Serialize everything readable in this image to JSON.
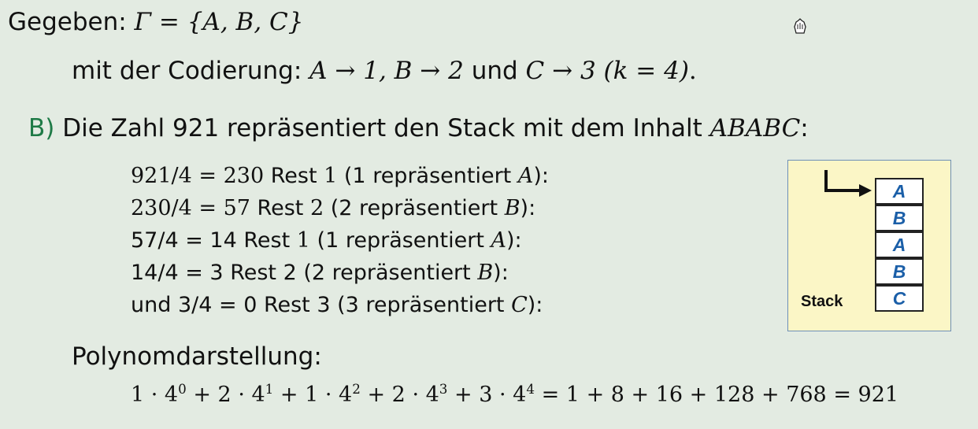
{
  "given": {
    "prefix": "Gegeben: ",
    "math": "Γ = {A, B, C}"
  },
  "coding": {
    "prefix": "mit der Codierung: ",
    "m1": "A → 1, B → 2",
    "und": " und ",
    "m2": "C → 3",
    "m3": "(k = 4)",
    "end": "."
  },
  "part_b": {
    "label": "B)",
    "text": "Die Zahl 921 repräsentiert den Stack mit dem Inhalt ",
    "content": "ABABC",
    "end": ":"
  },
  "calc_lines": [
    {
      "pre": "",
      "eq": "921/4 = 230",
      "rest": " Rest ",
      "r": "1",
      "paren": " (1 repräsentiert ",
      "sym": "A",
      "end": "):"
    },
    {
      "pre": "",
      "eq": "230/4 = 57",
      "rest": " Rest ",
      "r": "2",
      "paren": " (2 repräsentiert ",
      "sym": "B",
      "end": "):"
    },
    {
      "pre": "",
      "eq": "57/4 = 14",
      "rest": " Rest ",
      "r": "1",
      "paren": " (1 repräsentiert ",
      "sym": "A",
      "end": "):"
    },
    {
      "pre": "",
      "eq": "14/4 = 3",
      "rest": " Rest ",
      "r": "2",
      "paren": " (2 repräsentiert ",
      "sym": "B",
      "end": "):"
    },
    {
      "pre": "und ",
      "eq": "3/4 = 0",
      "rest": " Rest ",
      "r": "3",
      "paren": " (3 repräsentiert ",
      "sym": "C",
      "end": "):"
    }
  ],
  "stack": {
    "cells": [
      "A",
      "B",
      "A",
      "B",
      "C"
    ],
    "label": "Stack"
  },
  "poly": {
    "heading": "Polynomdarstellung:",
    "terms": [
      {
        "c": "1 · 4",
        "e": "0"
      },
      {
        "c": " + 2 · 4",
        "e": "1"
      },
      {
        "c": " + 1 · 4",
        "e": "2"
      },
      {
        "c": " + 2 · 4",
        "e": "3"
      },
      {
        "c": " + 3 · 4",
        "e": "4"
      }
    ],
    "result": " = 1 + 8 + 16 + 128 + 768 = 921"
  },
  "colors": {
    "background": "#e3ebe2",
    "label_b": "#1e7a46",
    "stack_bg": "#fbf6c6",
    "stack_letters": "#1b5fa8"
  },
  "icons": {
    "cursor": "pointer-hand-icon"
  }
}
